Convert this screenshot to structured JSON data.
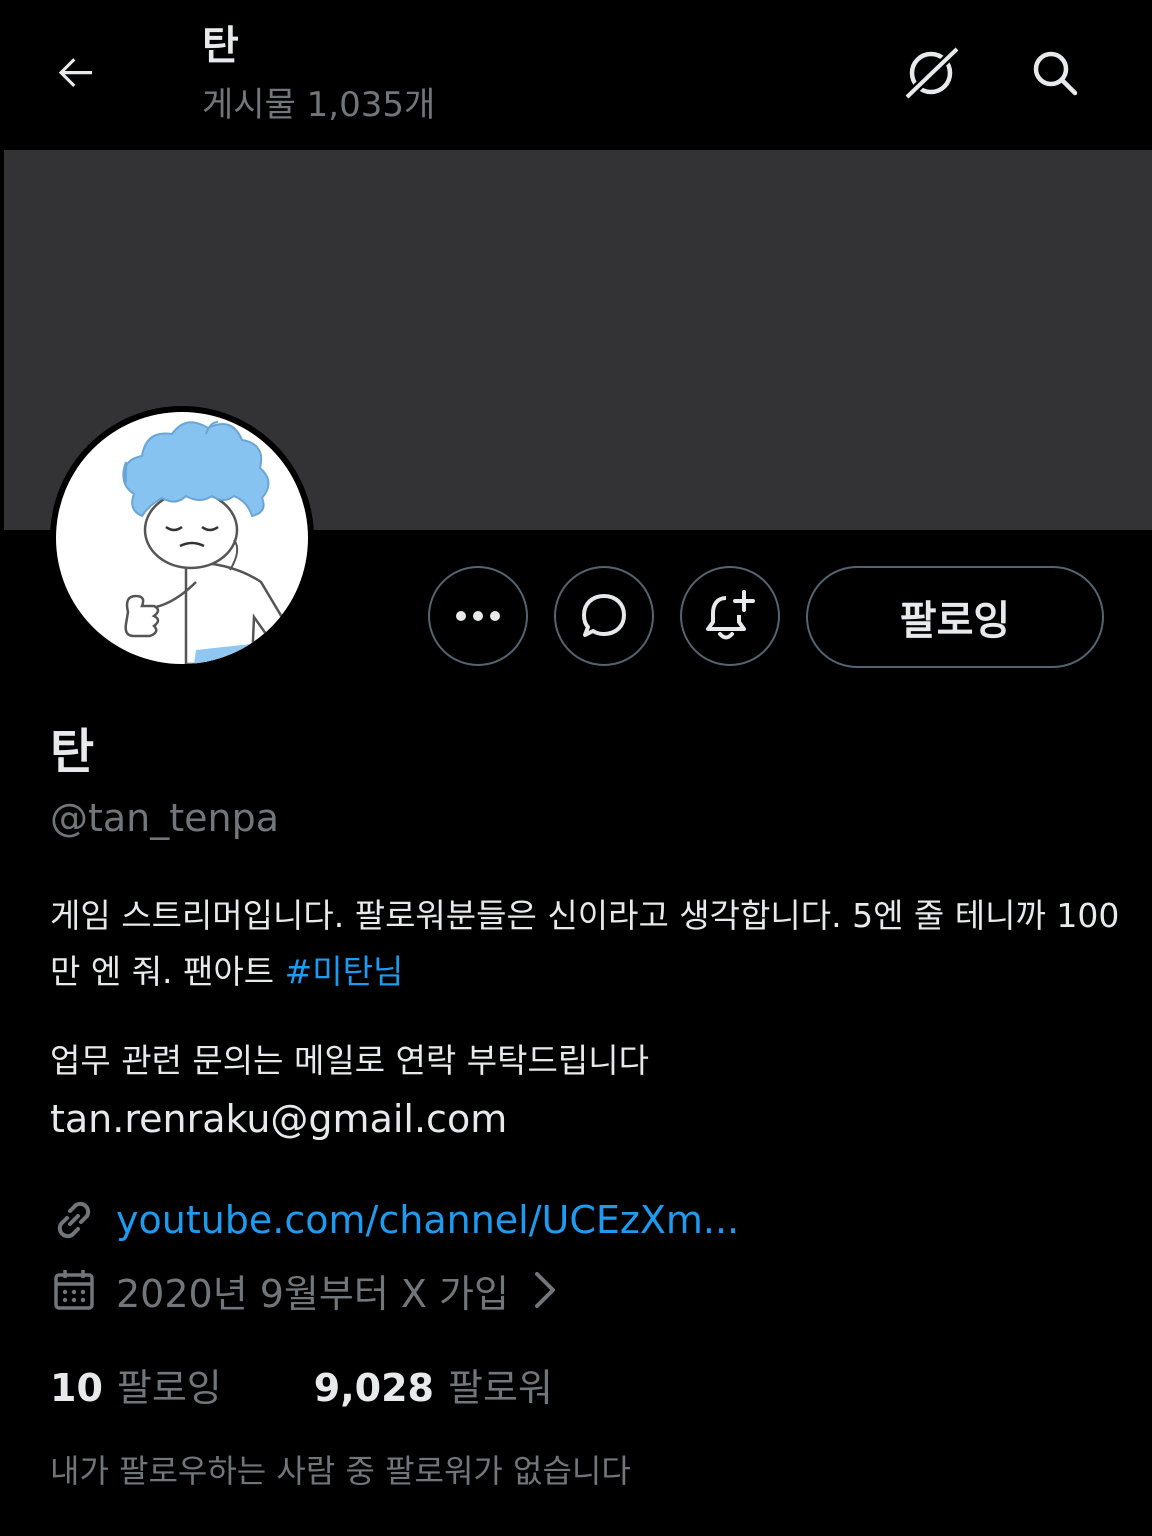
{
  "header": {
    "title": "탄",
    "post_count": "게시물 1,035개",
    "icons": [
      "back-arrow-icon",
      "no-grok-icon",
      "search-icon"
    ]
  },
  "profile": {
    "display_name": "탄",
    "handle": "@tan_tenpa",
    "follow_button_label": "팔로잉",
    "action_icons": [
      "more-icon",
      "message-icon",
      "notification-bell-icon"
    ],
    "bio_text": "게임 스트리머입니다. 팔로워분들은 신이라고 생각합니다. 5엔 줄 테니까 100만 엔 줘. 팬아트 ",
    "bio_hashtag": "#미탄님",
    "bio_line2": "업무 관련 문의는 메일로 연락 부탁드립니다",
    "email": "tan.renraku@gmail.com",
    "website": "youtube.com/channel/UCEzXm...",
    "joined": "2020년 9월부터 X 가입",
    "following_count": "10",
    "following_label": "팔로잉",
    "followers_count": "9,028",
    "followers_label": "팔로워",
    "mutual_followers_note": "내가 팔로우하는 사람 중 팔로워가 없습니다"
  },
  "colors": {
    "background": "#000000",
    "banner": "#333336",
    "text_primary": "#e7e9ea",
    "text_secondary": "#71767b",
    "link": "#1d9bf0",
    "border": "#536471"
  }
}
